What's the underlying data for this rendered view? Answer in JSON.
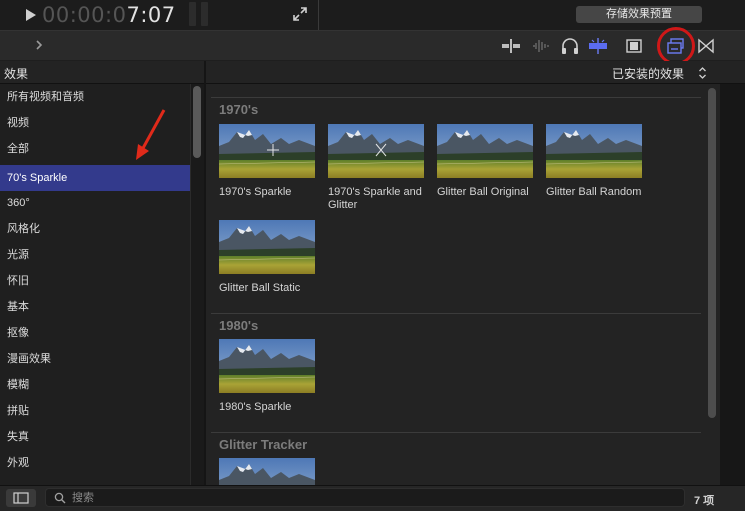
{
  "playback": {
    "timecode_dim": "00:00:0",
    "timecode_bright": "7:07"
  },
  "header": {
    "save_preset_label": "存储效果预置"
  },
  "effects_browser": {
    "title": "效果",
    "filter_dropdown": "已安装的效果",
    "categories": [
      {
        "label": "所有视频和音频"
      },
      {
        "label": "视频"
      },
      {
        "label": "全部"
      },
      {
        "label": "70's Sparkle",
        "selected": true
      },
      {
        "label": "360°"
      },
      {
        "label": "风格化"
      },
      {
        "label": "光源"
      },
      {
        "label": "怀旧"
      },
      {
        "label": "基本"
      },
      {
        "label": "抠像"
      },
      {
        "label": "漫画效果"
      },
      {
        "label": "模糊"
      },
      {
        "label": "拼贴"
      },
      {
        "label": "失真"
      },
      {
        "label": "外观"
      }
    ],
    "sections": [
      {
        "title": "1970's",
        "items": [
          {
            "label": "1970's Sparkle",
            "overlay": "plus"
          },
          {
            "label": "1970's Sparkle and Glitter",
            "overlay": "x"
          },
          {
            "label": "Glitter Ball Original",
            "overlay": "none"
          },
          {
            "label": "Glitter Ball Random",
            "overlay": "none"
          },
          {
            "label": "Glitter Ball Static",
            "overlay": "none"
          }
        ]
      },
      {
        "title": "1980's",
        "items": [
          {
            "label": "1980's Sparkle",
            "overlay": "none"
          }
        ]
      },
      {
        "title": "Glitter Tracker",
        "items": [
          {
            "label": "",
            "overlay": "none"
          }
        ]
      }
    ]
  },
  "footer": {
    "search_placeholder": "搜索",
    "item_count": "7 项"
  },
  "colors": {
    "selection": "#333a8c",
    "accent_blue": "#5b6cf0",
    "highlight_ring": "#d01818",
    "annotation_arrow": "#e02a1a"
  },
  "icons": [
    "play-icon",
    "fullscreen-icon",
    "chevron-right-icon",
    "video-audio-split-icon",
    "audio-waveform-icon",
    "headphones-icon",
    "skimming-icon",
    "filmstrip-icon",
    "effects-browser-icon",
    "transitions-icon",
    "up-down-icon",
    "search-icon",
    "sidebar-toggle-icon"
  ]
}
